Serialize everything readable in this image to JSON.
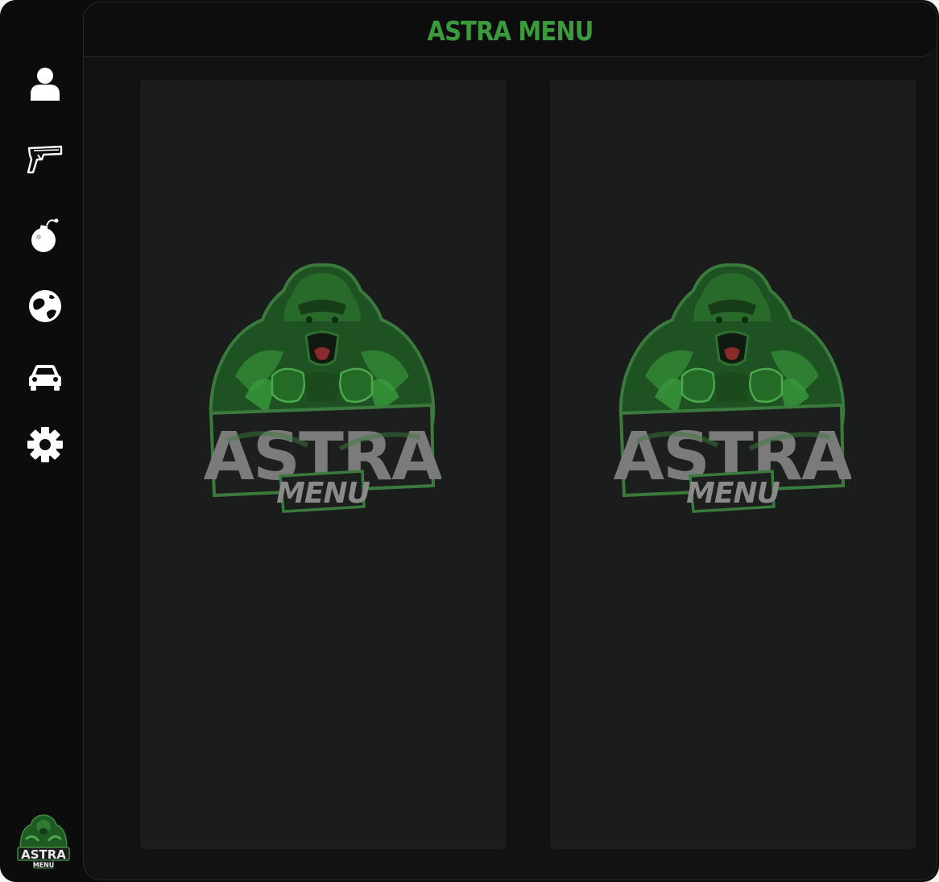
{
  "app": {
    "title": "ASTRA MENU"
  },
  "sidebar": {
    "items": [
      {
        "id": "player",
        "icon": "user-icon"
      },
      {
        "id": "weapon",
        "icon": "pistol-icon"
      },
      {
        "id": "explosive",
        "icon": "bomb-icon"
      },
      {
        "id": "world",
        "icon": "globe-icon"
      },
      {
        "id": "vehicle",
        "icon": "car-icon"
      },
      {
        "id": "settings",
        "icon": "gear-icon"
      }
    ],
    "logo": {
      "icon": "gorilla-logo-icon",
      "text_top": "ASTRA",
      "text_bottom": "MENU"
    }
  },
  "panels": [
    {
      "id": "left",
      "logo": {
        "icon": "gorilla-logo-icon",
        "text_top": "ASTRA",
        "text_bottom": "MENU"
      }
    },
    {
      "id": "right",
      "logo": {
        "icon": "gorilla-logo-icon",
        "text_top": "ASTRA",
        "text_bottom": "MENU"
      }
    }
  ],
  "colors": {
    "accent": "#3a9a3c",
    "background": "#0b0b0b",
    "panel": "#1b1c1c",
    "icon": "#ffffff"
  }
}
